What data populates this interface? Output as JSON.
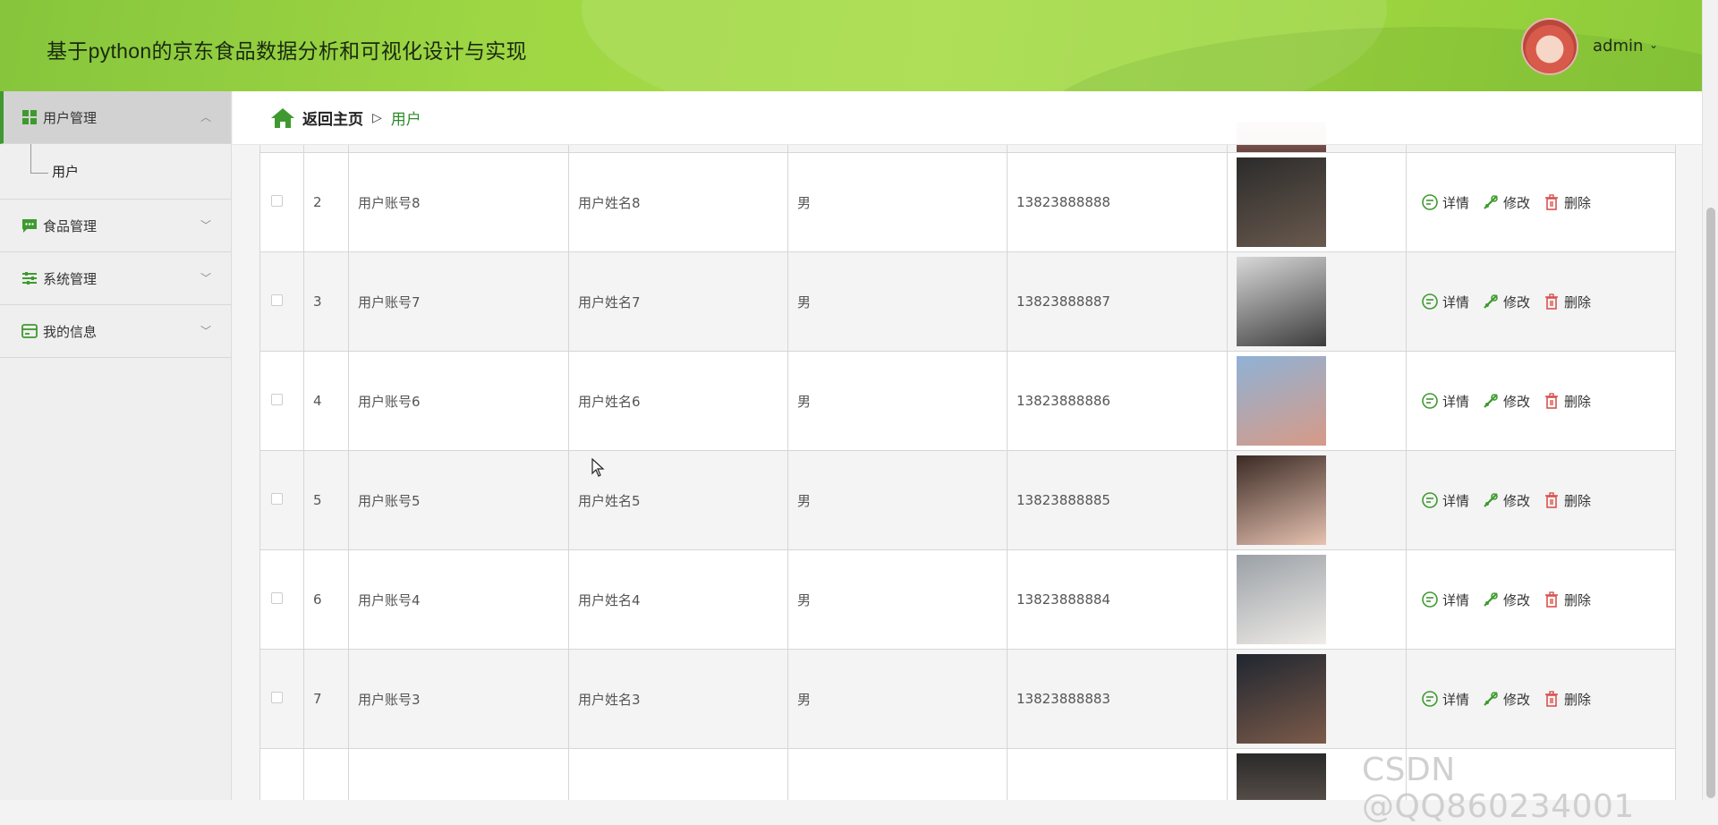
{
  "app": {
    "title": "基于python的京东食品数据分析和可视化设计与实现",
    "user": "admin"
  },
  "sidebar": {
    "groups": [
      {
        "label": "用户管理",
        "icon": "grid-icon",
        "expanded": true,
        "children": [
          {
            "label": "用户"
          }
        ]
      },
      {
        "label": "食品管理",
        "icon": "chat-icon"
      },
      {
        "label": "系统管理",
        "icon": "sliders-icon"
      },
      {
        "label": "我的信息",
        "icon": "card-icon"
      }
    ]
  },
  "breadcrumb": {
    "home": "返回主页",
    "separator": "▷",
    "current": "用户"
  },
  "table": {
    "actions": {
      "detail": "详情",
      "edit": "修改",
      "delete": "删除"
    },
    "rows": [
      {
        "index": "2",
        "account": "用户账号8",
        "name": "用户姓名8",
        "gender": "男",
        "phone": "13823888888",
        "photo_colors": [
          "#2b2b2b",
          "#6a5a4e"
        ]
      },
      {
        "index": "3",
        "account": "用户账号7",
        "name": "用户姓名7",
        "gender": "男",
        "phone": "13823888887",
        "photo_colors": [
          "#d9d9d9",
          "#3c3c3c"
        ]
      },
      {
        "index": "4",
        "account": "用户账号6",
        "name": "用户姓名6",
        "gender": "男",
        "phone": "13823888886",
        "photo_colors": [
          "#8fb2d6",
          "#d79a86"
        ]
      },
      {
        "index": "5",
        "account": "用户账号5",
        "name": "用户姓名5",
        "gender": "男",
        "phone": "13823888885",
        "photo_colors": [
          "#3a2a24",
          "#e7c2b1"
        ]
      },
      {
        "index": "6",
        "account": "用户账号4",
        "name": "用户姓名4",
        "gender": "男",
        "phone": "13823888884",
        "photo_colors": [
          "#9aa0a6",
          "#f0ece8"
        ]
      },
      {
        "index": "7",
        "account": "用户账号3",
        "name": "用户姓名3",
        "gender": "男",
        "phone": "13823888883",
        "photo_colors": [
          "#1f2630",
          "#7c5b4a"
        ]
      }
    ]
  },
  "colors": {
    "header": "#a6dc46",
    "accent": "#2f8a2a",
    "delete": "#d9534f"
  },
  "watermark": "CSDN @QQ860234001"
}
